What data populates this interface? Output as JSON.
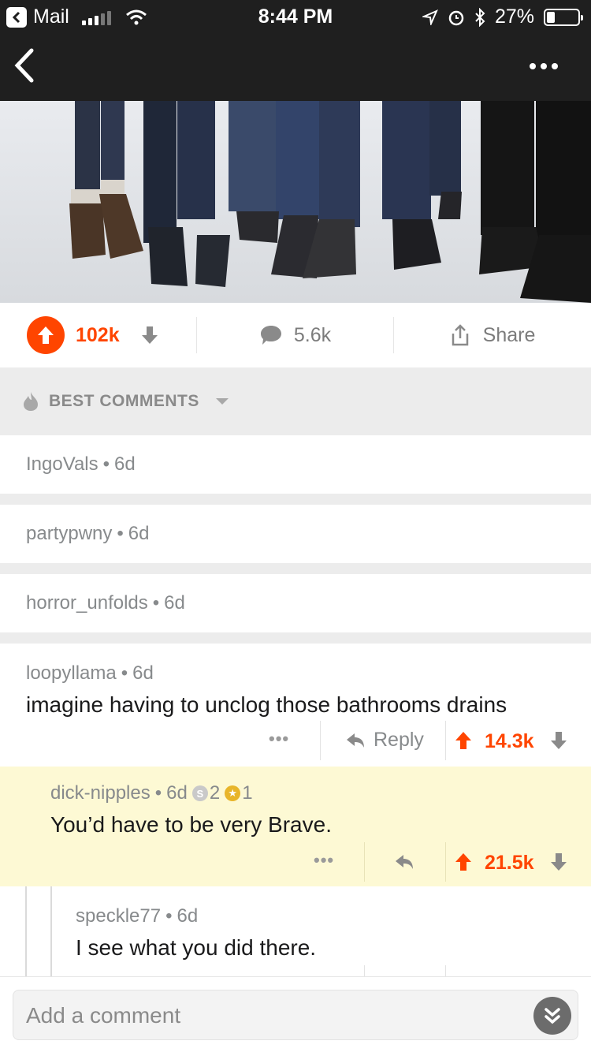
{
  "status_bar": {
    "back_app": "Mail",
    "time": "8:44 PM",
    "battery": "27%",
    "battery_level": 0.27
  },
  "nav": {
    "back_icon": "chevron-left-icon",
    "more_icon": "ellipsis-icon"
  },
  "post_actions": {
    "score": "102k",
    "comments": "5.6k",
    "share": "Share"
  },
  "sort": {
    "label": "BEST COMMENTS"
  },
  "collapsed_comments": [
    {
      "author": "IngoVals",
      "age": "6d"
    },
    {
      "author": "partypwny",
      "age": "6d"
    },
    {
      "author": "horror_unfolds",
      "age": "6d"
    }
  ],
  "comments": [
    {
      "author": "loopyllama",
      "age": "6d",
      "body": "imagine having to unclog those bathrooms drains",
      "reply_label": "Reply",
      "score": "14.3k"
    },
    {
      "author": "dick-nipples",
      "age": "6d",
      "silver_count": "2",
      "gold_count": "1",
      "body": "You’d have to be very Brave.",
      "score": "21.5k"
    },
    {
      "author": "speckle77",
      "age": "6d",
      "body": "I see what you did there."
    }
  ],
  "composer": {
    "placeholder": "Add a comment"
  },
  "colors": {
    "accent": "#ff4500",
    "highlight": "#fdf9d4",
    "bar": "#1f1f1f"
  }
}
